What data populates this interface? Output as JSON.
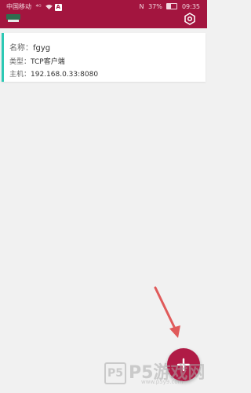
{
  "status_bar": {
    "carrier": "中国移动",
    "signal": "⁴ᴳ",
    "nfc": "N",
    "battery_percent_text": "37%",
    "battery_level": 0.37,
    "time": "09:35"
  },
  "connection": {
    "name_label": "名称：",
    "name_value": "fgyg",
    "type_label": "类型：",
    "type_value": "TCP客户端",
    "host_label": "主机：",
    "host_value": "192.168.0.33:8080"
  },
  "watermark": {
    "logo_text": "P5",
    "text": "P5游戏网",
    "subtext": "www.p5y9.com"
  },
  "colors": {
    "header": "#a3153f",
    "accent": "#2cc9b5",
    "fab": "#b01b46",
    "arrow": "#e05a5a"
  }
}
